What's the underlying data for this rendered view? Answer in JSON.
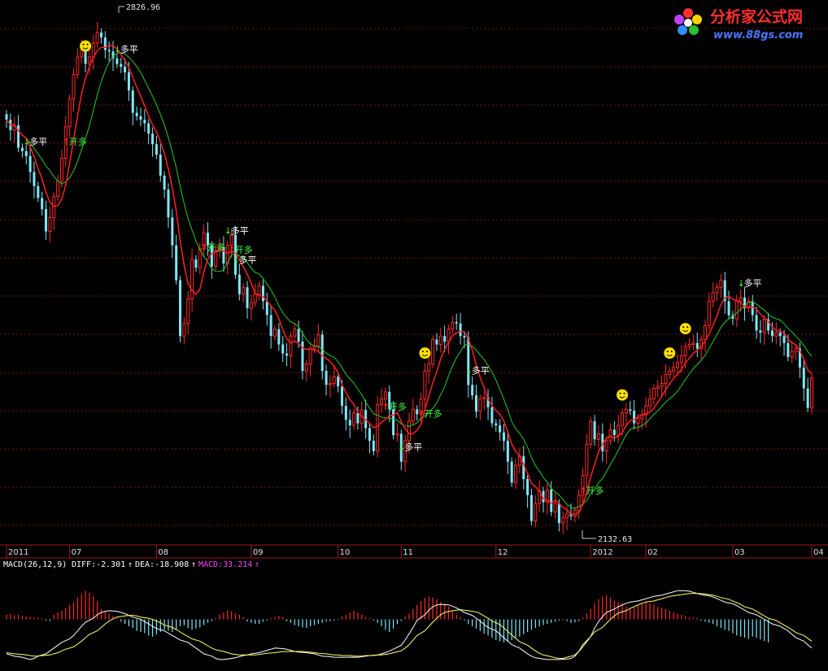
{
  "colors": {
    "background": "#000000",
    "grid": "#7a1414",
    "up": "#ff2a2a",
    "down": "#7fe7f7",
    "signal_blue": "#3a3aff",
    "signal_gold": "#ffd88a",
    "ma_fast": "#ff2020",
    "ma_slow": "#22cc22",
    "text": "#ffffff",
    "macd_label": "#ff40ff",
    "logo_red": "#ff3030",
    "logo_blue": "#4a78ff"
  },
  "logo": {
    "title": "分析家公式网",
    "url": "www.88gs.com"
  },
  "annotations": {
    "high": "2826.96",
    "low": "2132.63"
  },
  "signals": {
    "open_long": "开多",
    "close_long": "多平"
  },
  "macd": {
    "label": "MACD(26,12,9)",
    "diff": "DIFF:-2.301",
    "dea": "DEA:-18.908",
    "macd": "MACD:33.214"
  },
  "chart_data": [
    {
      "type": "candlestick",
      "title": "",
      "x_ticks": [
        "2011",
        "07",
        "08",
        "09",
        "10",
        "11",
        "12",
        "2012",
        "02",
        "03",
        "04"
      ],
      "ylim": [
        2100,
        2860
      ],
      "y_grid_lines": 14,
      "extremes": {
        "max": 2826.96,
        "min": 2132.63
      },
      "series": [
        {
          "type": "candles",
          "values": [
            2700,
            2685,
            2692,
            2660,
            2655,
            2648,
            2625,
            2605,
            2588,
            2572,
            2540,
            2560,
            2590,
            2612,
            2645,
            2690,
            2730,
            2765,
            2790,
            2800,
            2780,
            2790,
            2810,
            2825,
            2818,
            2800,
            2798,
            2788,
            2780,
            2776,
            2768,
            2742,
            2710,
            2705,
            2700,
            2695,
            2680,
            2665,
            2650,
            2620,
            2600,
            2560,
            2520,
            2470,
            2390,
            2408,
            2443,
            2500,
            2488,
            2515,
            2538,
            2520,
            2490,
            2512,
            2518,
            2494,
            2520,
            2535,
            2478,
            2450,
            2460,
            2430,
            2438,
            2450,
            2462,
            2440,
            2420,
            2390,
            2400,
            2378,
            2365,
            2362,
            2390,
            2400,
            2382,
            2340,
            2350,
            2372,
            2375,
            2392,
            2340,
            2320,
            2322,
            2332,
            2318,
            2290,
            2270,
            2262,
            2280,
            2265,
            2284,
            2258,
            2240,
            2225,
            2292,
            2300,
            2310,
            2285,
            2248,
            2250,
            2210,
            2240,
            2268,
            2285,
            2278,
            2300,
            2340,
            2350,
            2385,
            2378,
            2390,
            2382,
            2400,
            2410,
            2408,
            2390,
            2388,
            2320,
            2305,
            2282,
            2300,
            2302,
            2288,
            2265,
            2262,
            2252,
            2240,
            2210,
            2180,
            2205,
            2218,
            2185,
            2162,
            2125,
            2150,
            2168,
            2152,
            2170,
            2138,
            2150,
            2122,
            2130,
            2135,
            2132,
            2140,
            2162,
            2190,
            2235,
            2268,
            2242,
            2250,
            2225,
            2240,
            2256,
            2248,
            2262,
            2280,
            2285,
            2283,
            2265,
            2272,
            2277,
            2290,
            2300,
            2315,
            2318,
            2322,
            2335,
            2340,
            2345,
            2352,
            2362,
            2375,
            2378,
            2380,
            2372,
            2385,
            2405,
            2440,
            2452,
            2460,
            2470,
            2440,
            2420,
            2415,
            2440,
            2445,
            2430,
            2440,
            2420,
            2398,
            2395,
            2414,
            2398,
            2390,
            2395,
            2390,
            2380,
            2360,
            2368,
            2372,
            2345,
            2315,
            2287,
            2330
          ]
        }
      ]
    },
    {
      "type": "bar",
      "title": "MACD(26,12,9)",
      "ylim": [
        -80,
        80
      ],
      "series": [
        {
          "name": "MACD",
          "values": [
            8,
            9,
            7,
            8,
            6,
            5,
            4,
            3,
            3,
            2,
            -2,
            -3,
            8,
            12,
            15,
            20,
            25,
            30,
            38,
            45,
            50,
            46,
            40,
            32,
            18,
            14,
            10,
            6,
            2,
            -4,
            -8,
            -12,
            -15,
            -20,
            -22,
            -24,
            -28,
            -30,
            -26,
            -22,
            -18,
            -20,
            -22,
            -18,
            -12,
            -10,
            -15,
            -18,
            -16,
            -14,
            -10,
            -6,
            -3,
            2,
            8,
            12,
            16,
            14,
            10,
            8,
            4,
            -4,
            -6,
            -8,
            -8,
            -4,
            -2,
            2,
            4,
            6,
            4,
            -3,
            -6,
            -10,
            -12,
            -14,
            -15,
            -12,
            -10,
            -8,
            -6,
            -4,
            -3,
            -2,
            -1,
            5,
            8,
            12,
            15,
            12,
            8,
            4,
            2,
            -2,
            -6,
            -12,
            -18,
            -22,
            -16,
            -8,
            -3,
            5,
            10,
            18,
            25,
            32,
            38,
            40,
            38,
            35,
            30,
            28,
            22,
            15,
            8,
            4,
            -2,
            -8,
            -12,
            -16,
            -20,
            -25,
            -28,
            -32,
            -36,
            -38,
            -40,
            -38,
            -36,
            -32,
            -30,
            -26,
            -22,
            -18,
            -15,
            -12,
            -10,
            -8,
            -6,
            -4,
            -2,
            -1,
            -3,
            -6,
            -5,
            -3,
            3,
            10,
            18,
            28,
            35,
            40,
            42,
            38,
            32,
            30,
            28,
            22,
            18,
            20,
            24,
            28,
            30,
            28,
            26,
            22,
            20,
            18,
            15,
            12,
            10,
            8,
            6,
            4,
            3,
            2,
            -2,
            -4,
            -6,
            -8,
            -12,
            -15,
            -18,
            -20,
            -24,
            -28,
            -30,
            -32,
            -34,
            -30,
            -32,
            -35,
            -38,
            -40
          ]
        },
        {
          "name": "DIFF",
          "values": [
            -60,
            -62,
            -64,
            -66,
            -68,
            -70,
            -68,
            -64,
            -60,
            -55,
            -50,
            -45,
            -40,
            -34,
            -28,
            -20,
            -12,
            -5,
            2,
            8,
            12,
            14,
            15,
            14,
            12,
            10,
            7,
            4,
            0,
            -4,
            -8,
            -12,
            -16,
            -20,
            -24,
            -28,
            -32,
            -36,
            -40,
            -45,
            -50,
            -55,
            -60,
            -64,
            -68,
            -70,
            -70,
            -69,
            -67,
            -65,
            -63,
            -62,
            -60,
            -58,
            -56,
            -54,
            -52,
            -50,
            -51,
            -52,
            -54,
            -56,
            -57,
            -58,
            -59,
            -60,
            -62,
            -64,
            -65,
            -66,
            -66,
            -66,
            -66,
            -66,
            -66,
            -65,
            -64,
            -63,
            -62,
            -60,
            -58,
            -55,
            -52,
            -45,
            -36,
            -25,
            -14,
            -2,
            8,
            16,
            22,
            25,
            26,
            25,
            23,
            20,
            16,
            12,
            7,
            2,
            -3,
            -9,
            -14,
            -20,
            -26,
            -32,
            -38,
            -44,
            -50,
            -55,
            -60,
            -64,
            -67,
            -69,
            -70,
            -70,
            -70,
            -70,
            -69,
            -68,
            -64,
            -56,
            -44,
            -30,
            -15,
            -4,
            5,
            12,
            18,
            22,
            25,
            28,
            30,
            32,
            34,
            36,
            38,
            40,
            42,
            44,
            46,
            48,
            50,
            50,
            49,
            47,
            45,
            43,
            41,
            39,
            36,
            33,
            30,
            27,
            24,
            20,
            16,
            12,
            8,
            4,
            0,
            -4,
            -8,
            -12,
            -16,
            -20,
            -26,
            -32,
            -38,
            -44,
            -50
          ]
        },
        {
          "name": "DEA",
          "values": [
            -58,
            -59,
            -60,
            -61,
            -62,
            -63,
            -64,
            -64,
            -63,
            -62,
            -60,
            -58,
            -55,
            -52,
            -48,
            -43,
            -38,
            -32,
            -26,
            -20,
            -14,
            -8,
            -3,
            1,
            4,
            6,
            7,
            7,
            6,
            4,
            2,
            0,
            -3,
            -6,
            -10,
            -14,
            -18,
            -22,
            -26,
            -30,
            -34,
            -38,
            -42,
            -46,
            -50,
            -53,
            -56,
            -58,
            -60,
            -61,
            -62,
            -62,
            -62,
            -62,
            -61,
            -60,
            -59,
            -58,
            -57,
            -56,
            -56,
            -56,
            -56,
            -56,
            -57,
            -57,
            -58,
            -59,
            -60,
            -61,
            -62,
            -62,
            -63,
            -63,
            -64,
            -64,
            -64,
            -63,
            -63,
            -62,
            -62,
            -61,
            -60,
            -58,
            -55,
            -50,
            -44,
            -36,
            -28,
            -20,
            -12,
            -5,
            2,
            8,
            12,
            15,
            16,
            17,
            16,
            15,
            13,
            10,
            6,
            2,
            -3,
            -9,
            -15,
            -21,
            -27,
            -33,
            -39,
            -45,
            -50,
            -55,
            -59,
            -62,
            -65,
            -67,
            -68,
            -68,
            -66,
            -62,
            -56,
            -48,
            -39,
            -30,
            -22,
            -14,
            -7,
            0,
            6,
            11,
            15,
            19,
            22,
            25,
            28,
            30,
            32,
            34,
            36,
            38,
            40,
            42,
            43,
            44,
            45,
            45,
            45,
            44,
            43,
            42,
            40,
            38,
            35,
            32,
            29,
            26,
            22,
            18,
            14,
            10,
            6,
            2,
            -2,
            -6,
            -10,
            -14,
            -18,
            -23,
            -28,
            -33,
            -38
          ]
        }
      ]
    }
  ]
}
